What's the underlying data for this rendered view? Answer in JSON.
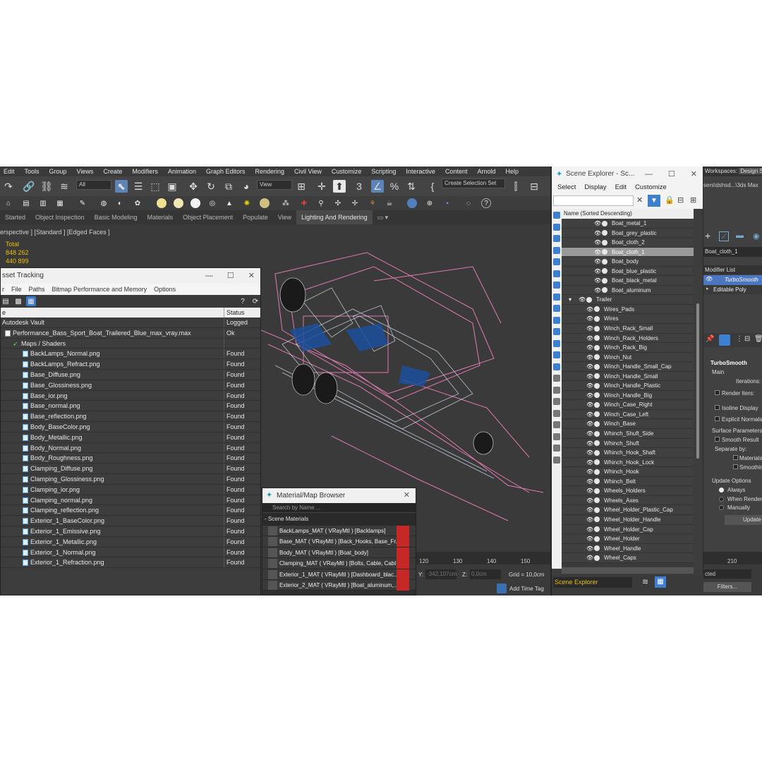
{
  "menubar": [
    "Edit",
    "Tools",
    "Group",
    "Views",
    "Create",
    "Modifiers",
    "Animation",
    "Graph Editors",
    "Rendering",
    "Civil View",
    "Customize",
    "Scripting",
    "Interactive",
    "Content",
    "Arnold",
    "Help"
  ],
  "toolbar": {
    "filter_all": "All",
    "view_dropdown": "View",
    "selection_set": "Create Selection Set"
  },
  "ribbon_tabs": [
    "Started",
    "Object Inspection",
    "Basic Modeling",
    "Materials",
    "Object Placement",
    "Populate",
    "View",
    "Lighting And Rendering"
  ],
  "ribbon_active": "Lighting And Rendering",
  "viewport": {
    "label": "erspective ] [Standard ] [Edged Faces ]",
    "stats_label": "Total",
    "stat1": "848 262",
    "stat2": "440 899"
  },
  "asset_tracking": {
    "title": "sset Tracking",
    "menu": [
      "r",
      "File",
      "Paths",
      "Bitmap Performance and Memory",
      "Options"
    ],
    "col_name": "e",
    "col_status": "Status",
    "vault": "Autodesk Vault",
    "vault_status": "Logged",
    "file": "Performance_Bass_Sport_Boat_Trailered_Blue_max_vray.max",
    "file_status": "Ok",
    "folder": "Maps / Shaders",
    "maps": [
      "BackLamps_Normal.png",
      "BackLamps_Refract.png",
      "Base_Diffuse.png",
      "Base_Glossiness.png",
      "Base_ior.png",
      "Base_normal.png",
      "Base_reflection.png",
      "Body_BaseColor.png",
      "Body_Metallic.png",
      "Body_Normal.png",
      "Body_Roughness.png",
      "Clamping_Diffuse.png",
      "Clamping_Glossiness.png",
      "Clamping_ior.png",
      "Clamping_normal.png",
      "Clamping_reflection.png",
      "Exterior_1_BaseColor.png",
      "Exterior_1_Emissive.png",
      "Exterior_1_Metallic.png",
      "Exterior_1_Normal.png",
      "Exterior_1_Refraction.png"
    ],
    "map_status": "Found"
  },
  "material_browser": {
    "title": "Material/Map Browser",
    "search_placeholder": "Search by Name ...",
    "section": "- Scene Materials",
    "items": [
      "BackLamps_MAT  ( VRayMtl )  [Backlamps]",
      "Base_MAT  ( VRayMtl )  [Back_Hooks, Base_Fr...",
      "Body_MAT  ( VRayMtl )  [Boat_body]",
      "Clamping_MAT  ( VRayMtl )  [Bolts, Cable, Cabl...",
      "Exterior_1_MAT  ( VRayMtl )  [Dashboard_blac...",
      "Exterior_2_MAT  ( VRayMtl )  [Boat_aluminum,..."
    ]
  },
  "scene_explorer": {
    "title": "Scene Explorer - Sc...",
    "menu": [
      "Select",
      "Display",
      "Edit",
      "Customize"
    ],
    "header": "Name (Sorted Descending)",
    "boat_items": [
      "Boat_metal_1",
      "Boat_grey_plastic",
      "Boat_cloth_2",
      "Boat_cloth_1",
      "Boat_body",
      "Boat_blue_plastic",
      "Boat_black_metal",
      "Boat_aluminum"
    ],
    "highlight": "Boat_cloth_1",
    "group": "Trailer",
    "trailer_items": [
      "Wires_Pads",
      "Wires",
      "Winch_Rack_Small",
      "Winch_Rack_Holders",
      "Winch_Rack_Big",
      "Winch_Nut",
      "Winch_Handle_Small_Cap",
      "Winch_Handle_Small",
      "Winch_Handle_Plastic",
      "Winch_Handle_Big",
      "Winch_Case_Right",
      "Winch_Case_Left",
      "Winch_Base",
      "Whinch_Shuft_Side",
      "Whinch_Shuft",
      "Whinch_Hook_Shaft",
      "Whinch_Hook_Lock",
      "Whinch_Hook",
      "Whinch_Belt",
      "Wheels_Holders",
      "Wheels_Axes",
      "Wheel_Holder_Plastic_Cap",
      "Wheel_Holder_Handle",
      "Wheel_Holder_Cap",
      "Wheel_Holder",
      "Wheel_Handle",
      "Wheel_Caps"
    ],
    "footer_dropdown": "Scene Explorer"
  },
  "command_panel": {
    "workspaces": "Workspaces:",
    "workspace_value": "Design S",
    "path": "sers\\dshsd...\\3ds Max",
    "object_name": "Boat_cloth_1",
    "modifier_list": "Modifier List",
    "stack": [
      "TurboSmooth",
      "Editable Poly"
    ],
    "rollout_title": "TurboSmooth",
    "main": "Main",
    "iterations": "Iterations:",
    "render_iters": "Render Iters:",
    "isoline": "Isoline Display",
    "explicit": "Explicit Normals",
    "surface": "Surface Parameters",
    "smooth_result": "Smooth Result",
    "separate": "Separate by:",
    "materials": "Materials",
    "smoothing": "Smoothin",
    "update_options": "Update Options",
    "always": "Always",
    "when_render": "When Render",
    "manually": "Manually",
    "update_btn": "Update",
    "selection_drop": "cted",
    "filters_btn": "Filters..."
  },
  "timeline": {
    "ticks": [
      "120",
      "130",
      "140",
      "150"
    ],
    "tick_right": "210",
    "y_label": "Y:",
    "y_value": "-342,107cm",
    "z_label": "Z:",
    "z_value": "0,0cm",
    "grid": "Grid = 10,0cm",
    "add_time_tag": "Add Time Tag"
  }
}
